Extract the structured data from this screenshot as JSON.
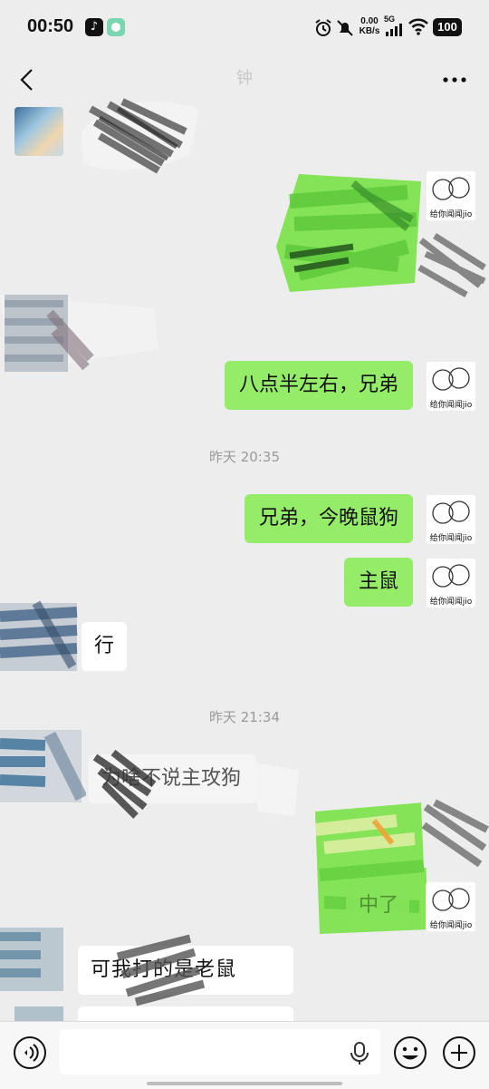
{
  "status_bar": {
    "time": "00:50",
    "net_speed_value": "0.00",
    "net_speed_unit": "KB/s",
    "network": "5G",
    "battery": "100"
  },
  "header": {
    "title": "钟"
  },
  "messages": {
    "out_1": "八点半左右，兄弟",
    "ts_1": "昨天 20:35",
    "out_2": "兄弟，今晚鼠狗",
    "out_3": "主鼠",
    "in_1": "行",
    "ts_2": "昨天 21:34",
    "in_2": "为啥不说主攻狗",
    "out_4": "中了",
    "in_3": "可我打的是老鼠",
    "self_avatar_caption": "给你闻闻jio"
  }
}
